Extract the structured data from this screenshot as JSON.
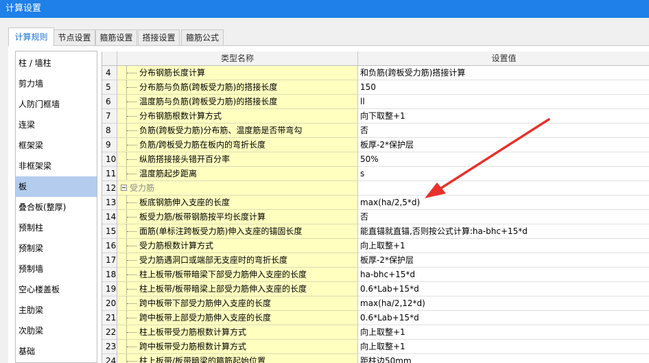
{
  "window": {
    "title": "计算设置"
  },
  "tabs": [
    {
      "label": "计算规则",
      "active": true
    },
    {
      "label": "节点设置",
      "active": false
    },
    {
      "label": "箍筋设置",
      "active": false
    },
    {
      "label": "搭接设置",
      "active": false
    },
    {
      "label": "箍筋公式",
      "active": false
    }
  ],
  "sidebar": {
    "items": [
      {
        "label": "柱 / 墙柱"
      },
      {
        "label": "剪力墙"
      },
      {
        "label": "人防门框墙"
      },
      {
        "label": "连梁"
      },
      {
        "label": "框架梁"
      },
      {
        "label": "非框架梁"
      },
      {
        "label": "板",
        "selected": true
      },
      {
        "label": "叠合板(整厚)"
      },
      {
        "label": "预制柱"
      },
      {
        "label": "预制梁"
      },
      {
        "label": "预制墙"
      },
      {
        "label": "空心楼盖板"
      },
      {
        "label": "主肋梁"
      },
      {
        "label": "次肋梁"
      },
      {
        "label": "基础"
      }
    ]
  },
  "grid": {
    "headers": {
      "name": "类型名称",
      "value": "设置值"
    },
    "rows": [
      {
        "num": "4",
        "name": "分布钢筋长度计算",
        "value": "和负筋(跨板受力筋)搭接计算"
      },
      {
        "num": "5",
        "name": "分布筋与负筋(跨板受力筋)的搭接长度",
        "value": "150"
      },
      {
        "num": "6",
        "name": "温度筋与负筋(跨板受力筋)的搭接长度",
        "value": "ll"
      },
      {
        "num": "7",
        "name": "分布钢筋根数计算方式",
        "value": "向下取整+1"
      },
      {
        "num": "8",
        "name": "负筋(跨板受力筋)分布筋、温度筋是否带弯勾",
        "value": "否"
      },
      {
        "num": "9",
        "name": "负筋/跨板受力筋在板内的弯折长度",
        "value": "板厚-2*保护层"
      },
      {
        "num": "10",
        "name": "纵筋搭接接头错开百分率",
        "value": "50%"
      },
      {
        "num": "11",
        "name": "温度筋起步距离",
        "value": "s"
      },
      {
        "num": "12",
        "name": "受力筋",
        "value": "",
        "group": true
      },
      {
        "num": "13",
        "name": "板底钢筋伸入支座的长度",
        "value": "max(ha/2,5*d)"
      },
      {
        "num": "14",
        "name": "板受力筋/板带钢筋按平均长度计算",
        "value": "否"
      },
      {
        "num": "15",
        "name": "面筋(单标注跨板受力筋)伸入支座的锚固长度",
        "value": "能直锚就直锚,否则按公式计算:ha-bhc+15*d"
      },
      {
        "num": "16",
        "name": "受力筋根数计算方式",
        "value": "向上取整+1"
      },
      {
        "num": "17",
        "name": "受力筋遇洞口或端部无支座时的弯折长度",
        "value": "板厚-2*保护层"
      },
      {
        "num": "18",
        "name": "柱上板带/板带暗梁下部受力筋伸入支座的长度",
        "value": "ha-bhc+15*d"
      },
      {
        "num": "19",
        "name": "柱上板带/板带暗梁上部受力筋伸入支座的长度",
        "value": "0.6*Lab+15*d"
      },
      {
        "num": "20",
        "name": "跨中板带下部受力筋伸入支座的长度",
        "value": "max(ha/2,12*d)"
      },
      {
        "num": "21",
        "name": "跨中板带上部受力筋伸入支座的长度",
        "value": "0.6*Lab+15*d"
      },
      {
        "num": "22",
        "name": "柱上板带受力筋根数计算方式",
        "value": "向上取整+1"
      },
      {
        "num": "23",
        "name": "跨中板带受力筋根数计算方式",
        "value": "向上取整+1"
      },
      {
        "num": "24",
        "name": "柱上板带/板带暗梁的箍筋起始位置",
        "value": "距柱边50mm"
      }
    ]
  },
  "colors": {
    "titlebar": "#1e80e8",
    "name_cell": "#ffffc0",
    "selected_item": "#b4cdee",
    "arrow": "#e8302a"
  },
  "icons": {
    "expander": "minus-box-icon",
    "annotation": "red-arrow-icon"
  }
}
